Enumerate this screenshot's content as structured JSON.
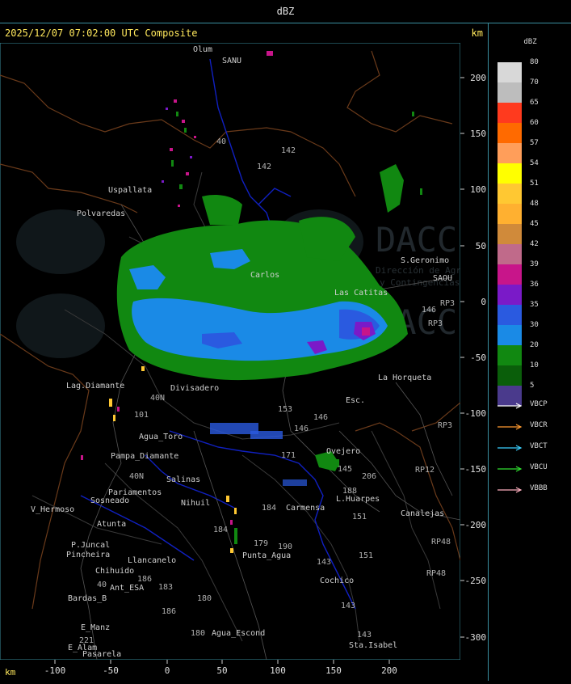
{
  "header": {
    "title": "dBZ"
  },
  "subheader": {
    "timestamp": "2025/12/07 07:02:00 UTC Composite",
    "unit": "km"
  },
  "axes": {
    "x_unit": "km",
    "x_ticks": [
      "-100",
      "-50",
      "0",
      "50",
      "100",
      "150",
      "200"
    ],
    "y_ticks": [
      "200",
      "150",
      "100",
      "50",
      "0",
      "-50",
      "-100",
      "-150",
      "-200",
      "-250",
      "-300"
    ]
  },
  "legend": {
    "title": "dBZ",
    "scale": [
      {
        "value": "80",
        "color": "#d8d8d8"
      },
      {
        "value": "70",
        "color": "#bdbdbd"
      },
      {
        "value": "65",
        "color": "#ff3a1e"
      },
      {
        "value": "60",
        "color": "#ff6a00"
      },
      {
        "value": "57",
        "color": "#ff9e5a"
      },
      {
        "value": "54",
        "color": "#ffff00"
      },
      {
        "value": "51",
        "color": "#ffc832"
      },
      {
        "value": "48",
        "color": "#ffb030"
      },
      {
        "value": "45",
        "color": "#d08a3a"
      },
      {
        "value": "42",
        "color": "#c06a8a"
      },
      {
        "value": "39",
        "color": "#c8158a"
      },
      {
        "value": "36",
        "color": "#7a1ac8"
      },
      {
        "value": "35",
        "color": "#2a5ae0"
      },
      {
        "value": "30",
        "color": "#1a8ae6"
      },
      {
        "value": "20",
        "color": "#118811"
      },
      {
        "value": "10",
        "color": "#0a5e0a"
      },
      {
        "value": "5",
        "color": "#4a3a8c"
      }
    ],
    "radars": [
      {
        "name": "VBCP",
        "color": "#ffffff"
      },
      {
        "name": "VBCR",
        "color": "#ff9a30"
      },
      {
        "name": "VBCT",
        "color": "#3ad0ff"
      },
      {
        "name": "VBCU",
        "color": "#30e030"
      },
      {
        "name": "VBBB",
        "color": "#ffb0c0"
      }
    ]
  },
  "watermark": {
    "brand": "DACC",
    "line1": "Dirección de Agricultura",
    "line2": "y Contingencias Climáticas"
  },
  "places": [
    {
      "name": "Olum",
      "color": "#cfcfcf"
    },
    {
      "name": "SANU",
      "color": "#cfcfcf"
    },
    {
      "name": "Uspallata",
      "color": "#cfcfcf"
    },
    {
      "name": "Polvaredas",
      "color": "#cfcfcf"
    },
    {
      "name": "S.Geronimo",
      "color": "#cfcfcf"
    },
    {
      "name": "SAOU",
      "color": "#cfcfcf"
    },
    {
      "name": "Carlos",
      "color": "#cfcfcf"
    },
    {
      "name": "Las Catitas",
      "color": "#cfcfcf"
    },
    {
      "name": "La Horqueta",
      "color": "#cfcfcf"
    },
    {
      "name": "Lag.Diamante",
      "color": "#cfcfcf"
    },
    {
      "name": "Divisadero",
      "color": "#cfcfcf"
    },
    {
      "name": "Agua_Toro",
      "color": "#cfcfcf"
    },
    {
      "name": "Pampa_Diamante",
      "color": "#cfcfcf"
    },
    {
      "name": "Salinas",
      "color": "#cfcfcf"
    },
    {
      "name": "Pariamentos",
      "color": "#cfcfcf"
    },
    {
      "name": "Sosneado",
      "color": "#cfcfcf"
    },
    {
      "name": "Nihuil",
      "color": "#cfcfcf"
    },
    {
      "name": "V_Hermoso",
      "color": "#cfcfcf"
    },
    {
      "name": "Atunta",
      "color": "#cfcfcf"
    },
    {
      "name": "P.Juncal",
      "color": "#cfcfcf"
    },
    {
      "name": "Pincheira",
      "color": "#cfcfcf"
    },
    {
      "name": "Llancanelo",
      "color": "#cfcfcf"
    },
    {
      "name": "Chihuido",
      "color": "#cfcfcf"
    },
    {
      "name": "Ant_ESA",
      "color": "#cfcfcf"
    },
    {
      "name": "Bardas_B",
      "color": "#cfcfcf"
    },
    {
      "name": "E_Manz",
      "color": "#cfcfcf"
    },
    {
      "name": "E_Alam",
      "color": "#cfcfcf"
    },
    {
      "name": "Pasarela",
      "color": "#cfcfcf"
    },
    {
      "name": "Agua_Escond",
      "color": "#cfcfcf"
    },
    {
      "name": "Punta_Agua",
      "color": "#cfcfcf"
    },
    {
      "name": "Carmensa",
      "color": "#cfcfcf"
    },
    {
      "name": "L.Huarpes",
      "color": "#cfcfcf"
    },
    {
      "name": "Cochico",
      "color": "#cfcfcf"
    },
    {
      "name": "Sta.Isabel",
      "color": "#cfcfcf"
    },
    {
      "name": "Ovejero",
      "color": "#cfcfcf"
    },
    {
      "name": "Canalejas",
      "color": "#cfcfcf"
    },
    {
      "name": "Esc.",
      "color": "#cfcfcf"
    }
  ],
  "route_labels": [
    "40",
    "142",
    "142",
    "153",
    "146",
    "146",
    "206",
    "188",
    "151",
    "151",
    "143",
    "143",
    "143",
    "184",
    "184",
    "180",
    "180",
    "186",
    "179",
    "190",
    "171",
    "145",
    "221",
    "40",
    "RP3",
    "RP3",
    "RP3",
    "RP12",
    "RP48",
    "RP48",
    "146",
    "101",
    "40N",
    "40N",
    "186",
    "183"
  ]
}
